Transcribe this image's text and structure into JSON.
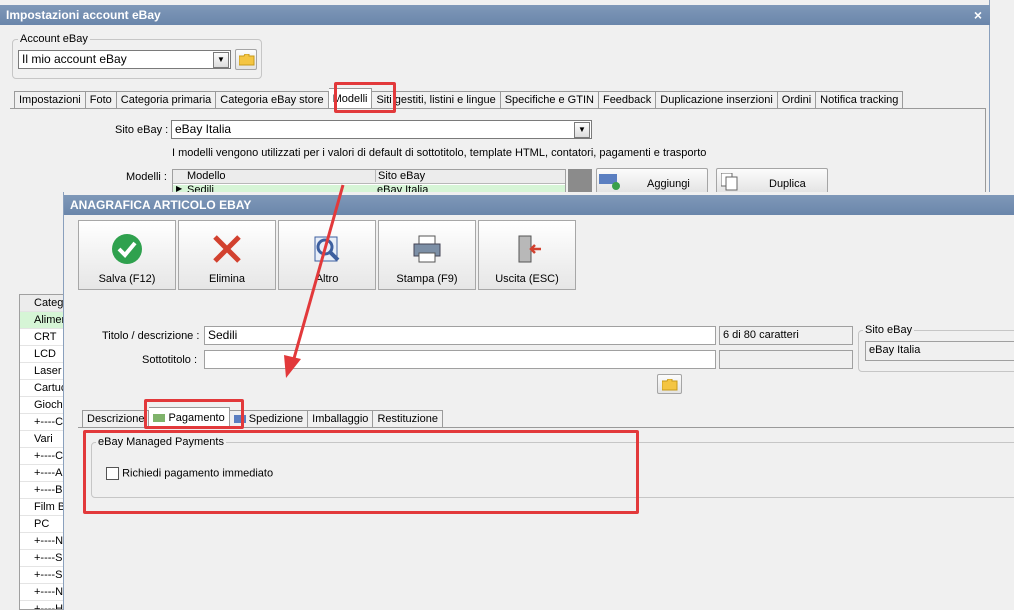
{
  "outer": {
    "title": "Impostazioni account eBay",
    "close_glyph": "×",
    "account_group_label": "Account eBay",
    "account_value": "Il mio account eBay",
    "tabs": [
      {
        "label": "Impostazioni"
      },
      {
        "label": "Foto"
      },
      {
        "label": "Categoria primaria"
      },
      {
        "label": "Categoria eBay store"
      },
      {
        "label": "Modelli"
      },
      {
        "label": "Siti gestiti, listini e lingue"
      },
      {
        "label": "Specifiche e GTIN"
      },
      {
        "label": "Feedback"
      },
      {
        "label": "Duplicazione inserzioni"
      },
      {
        "label": "Ordini"
      },
      {
        "label": "Notifica tracking"
      }
    ],
    "active_tab": "Modelli",
    "site_label": "Sito eBay :",
    "site_value": "eBay Italia",
    "info_text": "I modelli vengono utilizzati per i valori di default di sottotitolo, template HTML, contatori, pagamenti e trasporto",
    "models_label": "Modelli :",
    "models_columns": [
      "Modello",
      "Sito eBay"
    ],
    "models_rows": [
      {
        "model": "Sedili",
        "site": "eBay Italia"
      }
    ],
    "add_label": "Aggiungi",
    "duplicate_label": "Duplica",
    "category_list": [
      "Categ",
      "Alimen",
      "CRT",
      "LCD",
      "Laser",
      "Cartuc",
      "Giochi",
      "+----C",
      "Vari",
      "+----C",
      "+----A",
      "+----B",
      "Film Bl",
      "PC",
      "+----N",
      "+----S",
      "+----S",
      "+----N",
      "+----H"
    ]
  },
  "dialog": {
    "title": "ANAGRAFICA ARTICOLO EBAY",
    "toolbar": [
      {
        "label": "Salva (F12)",
        "icon": "check-icon"
      },
      {
        "label": "Elimina",
        "icon": "delete-x-icon"
      },
      {
        "label": "Altro",
        "icon": "magnifier-icon"
      },
      {
        "label": "Stampa (F9)",
        "icon": "printer-icon"
      },
      {
        "label": "Uscita (ESC)",
        "icon": "exit-door-icon"
      }
    ],
    "title_label": "Titolo / descrizione :",
    "title_value": "Sedili",
    "char_counter": "6 di 80 caratteri",
    "subtitle_label": "Sottotitolo :",
    "subtitle_value": "",
    "site_group_label": "Sito eBay",
    "site_value": "eBay Italia",
    "tabs": [
      {
        "label": "Descrizione"
      },
      {
        "label": "Pagamento"
      },
      {
        "label": "Spedizione"
      },
      {
        "label": "Imballaggio"
      },
      {
        "label": "Restituzione"
      }
    ],
    "active_tab": "Pagamento",
    "payments_group_label": "eBay Managed Payments",
    "immediate_payment_label": "Richiedi pagamento immediato",
    "immediate_payment_checked": false
  },
  "colors": {
    "titlebar": "#6a86ab",
    "highlight": "#e2393b",
    "selected_row": "#d6f5d6"
  }
}
